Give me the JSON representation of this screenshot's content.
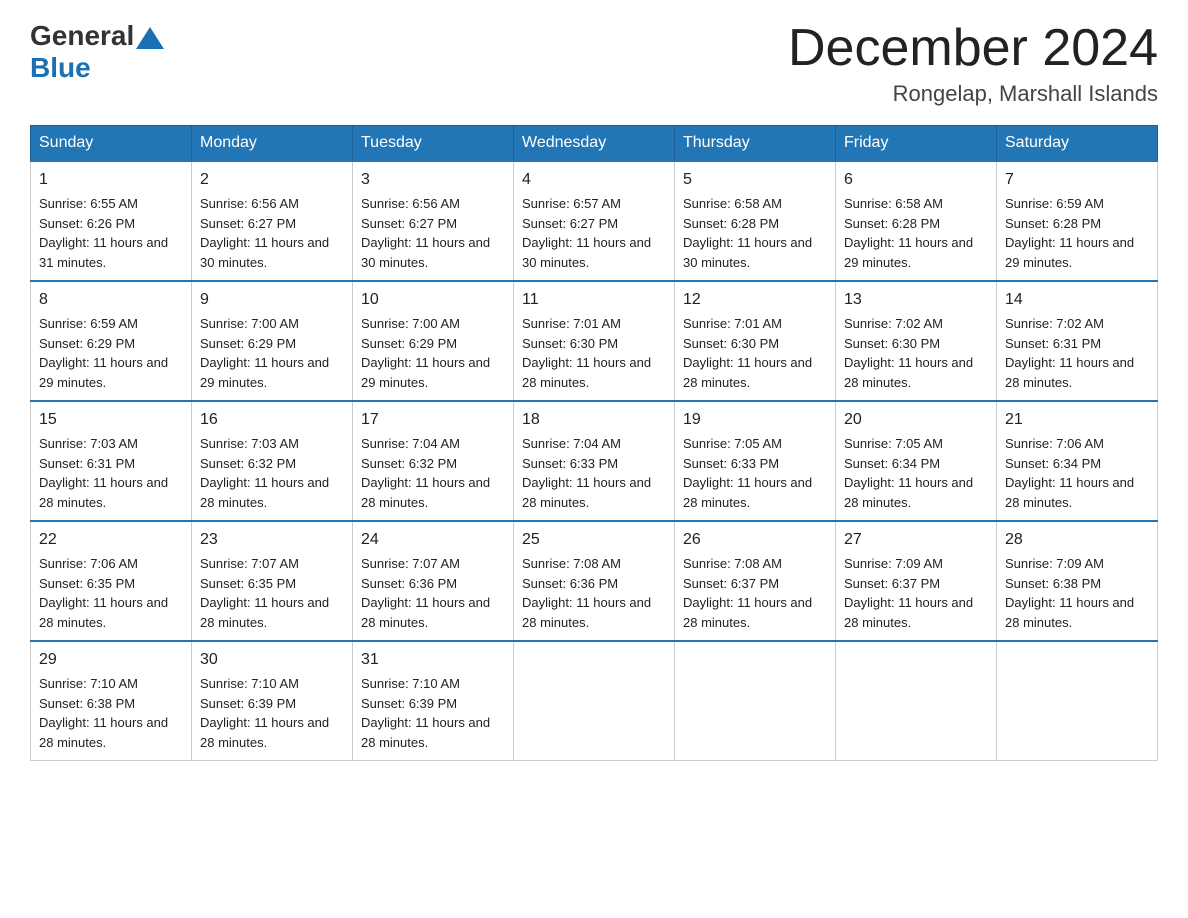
{
  "header": {
    "logo_general": "General",
    "logo_blue": "Blue",
    "month_year": "December 2024",
    "location": "Rongelap, Marshall Islands"
  },
  "columns": [
    "Sunday",
    "Monday",
    "Tuesday",
    "Wednesday",
    "Thursday",
    "Friday",
    "Saturday"
  ],
  "weeks": [
    [
      {
        "day": "1",
        "sunrise": "Sunrise: 6:55 AM",
        "sunset": "Sunset: 6:26 PM",
        "daylight": "Daylight: 11 hours and 31 minutes."
      },
      {
        "day": "2",
        "sunrise": "Sunrise: 6:56 AM",
        "sunset": "Sunset: 6:27 PM",
        "daylight": "Daylight: 11 hours and 30 minutes."
      },
      {
        "day": "3",
        "sunrise": "Sunrise: 6:56 AM",
        "sunset": "Sunset: 6:27 PM",
        "daylight": "Daylight: 11 hours and 30 minutes."
      },
      {
        "day": "4",
        "sunrise": "Sunrise: 6:57 AM",
        "sunset": "Sunset: 6:27 PM",
        "daylight": "Daylight: 11 hours and 30 minutes."
      },
      {
        "day": "5",
        "sunrise": "Sunrise: 6:58 AM",
        "sunset": "Sunset: 6:28 PM",
        "daylight": "Daylight: 11 hours and 30 minutes."
      },
      {
        "day": "6",
        "sunrise": "Sunrise: 6:58 AM",
        "sunset": "Sunset: 6:28 PM",
        "daylight": "Daylight: 11 hours and 29 minutes."
      },
      {
        "day": "7",
        "sunrise": "Sunrise: 6:59 AM",
        "sunset": "Sunset: 6:28 PM",
        "daylight": "Daylight: 11 hours and 29 minutes."
      }
    ],
    [
      {
        "day": "8",
        "sunrise": "Sunrise: 6:59 AM",
        "sunset": "Sunset: 6:29 PM",
        "daylight": "Daylight: 11 hours and 29 minutes."
      },
      {
        "day": "9",
        "sunrise": "Sunrise: 7:00 AM",
        "sunset": "Sunset: 6:29 PM",
        "daylight": "Daylight: 11 hours and 29 minutes."
      },
      {
        "day": "10",
        "sunrise": "Sunrise: 7:00 AM",
        "sunset": "Sunset: 6:29 PM",
        "daylight": "Daylight: 11 hours and 29 minutes."
      },
      {
        "day": "11",
        "sunrise": "Sunrise: 7:01 AM",
        "sunset": "Sunset: 6:30 PM",
        "daylight": "Daylight: 11 hours and 28 minutes."
      },
      {
        "day": "12",
        "sunrise": "Sunrise: 7:01 AM",
        "sunset": "Sunset: 6:30 PM",
        "daylight": "Daylight: 11 hours and 28 minutes."
      },
      {
        "day": "13",
        "sunrise": "Sunrise: 7:02 AM",
        "sunset": "Sunset: 6:30 PM",
        "daylight": "Daylight: 11 hours and 28 minutes."
      },
      {
        "day": "14",
        "sunrise": "Sunrise: 7:02 AM",
        "sunset": "Sunset: 6:31 PM",
        "daylight": "Daylight: 11 hours and 28 minutes."
      }
    ],
    [
      {
        "day": "15",
        "sunrise": "Sunrise: 7:03 AM",
        "sunset": "Sunset: 6:31 PM",
        "daylight": "Daylight: 11 hours and 28 minutes."
      },
      {
        "day": "16",
        "sunrise": "Sunrise: 7:03 AM",
        "sunset": "Sunset: 6:32 PM",
        "daylight": "Daylight: 11 hours and 28 minutes."
      },
      {
        "day": "17",
        "sunrise": "Sunrise: 7:04 AM",
        "sunset": "Sunset: 6:32 PM",
        "daylight": "Daylight: 11 hours and 28 minutes."
      },
      {
        "day": "18",
        "sunrise": "Sunrise: 7:04 AM",
        "sunset": "Sunset: 6:33 PM",
        "daylight": "Daylight: 11 hours and 28 minutes."
      },
      {
        "day": "19",
        "sunrise": "Sunrise: 7:05 AM",
        "sunset": "Sunset: 6:33 PM",
        "daylight": "Daylight: 11 hours and 28 minutes."
      },
      {
        "day": "20",
        "sunrise": "Sunrise: 7:05 AM",
        "sunset": "Sunset: 6:34 PM",
        "daylight": "Daylight: 11 hours and 28 minutes."
      },
      {
        "day": "21",
        "sunrise": "Sunrise: 7:06 AM",
        "sunset": "Sunset: 6:34 PM",
        "daylight": "Daylight: 11 hours and 28 minutes."
      }
    ],
    [
      {
        "day": "22",
        "sunrise": "Sunrise: 7:06 AM",
        "sunset": "Sunset: 6:35 PM",
        "daylight": "Daylight: 11 hours and 28 minutes."
      },
      {
        "day": "23",
        "sunrise": "Sunrise: 7:07 AM",
        "sunset": "Sunset: 6:35 PM",
        "daylight": "Daylight: 11 hours and 28 minutes."
      },
      {
        "day": "24",
        "sunrise": "Sunrise: 7:07 AM",
        "sunset": "Sunset: 6:36 PM",
        "daylight": "Daylight: 11 hours and 28 minutes."
      },
      {
        "day": "25",
        "sunrise": "Sunrise: 7:08 AM",
        "sunset": "Sunset: 6:36 PM",
        "daylight": "Daylight: 11 hours and 28 minutes."
      },
      {
        "day": "26",
        "sunrise": "Sunrise: 7:08 AM",
        "sunset": "Sunset: 6:37 PM",
        "daylight": "Daylight: 11 hours and 28 minutes."
      },
      {
        "day": "27",
        "sunrise": "Sunrise: 7:09 AM",
        "sunset": "Sunset: 6:37 PM",
        "daylight": "Daylight: 11 hours and 28 minutes."
      },
      {
        "day": "28",
        "sunrise": "Sunrise: 7:09 AM",
        "sunset": "Sunset: 6:38 PM",
        "daylight": "Daylight: 11 hours and 28 minutes."
      }
    ],
    [
      {
        "day": "29",
        "sunrise": "Sunrise: 7:10 AM",
        "sunset": "Sunset: 6:38 PM",
        "daylight": "Daylight: 11 hours and 28 minutes."
      },
      {
        "day": "30",
        "sunrise": "Sunrise: 7:10 AM",
        "sunset": "Sunset: 6:39 PM",
        "daylight": "Daylight: 11 hours and 28 minutes."
      },
      {
        "day": "31",
        "sunrise": "Sunrise: 7:10 AM",
        "sunset": "Sunset: 6:39 PM",
        "daylight": "Daylight: 11 hours and 28 minutes."
      },
      null,
      null,
      null,
      null
    ]
  ]
}
